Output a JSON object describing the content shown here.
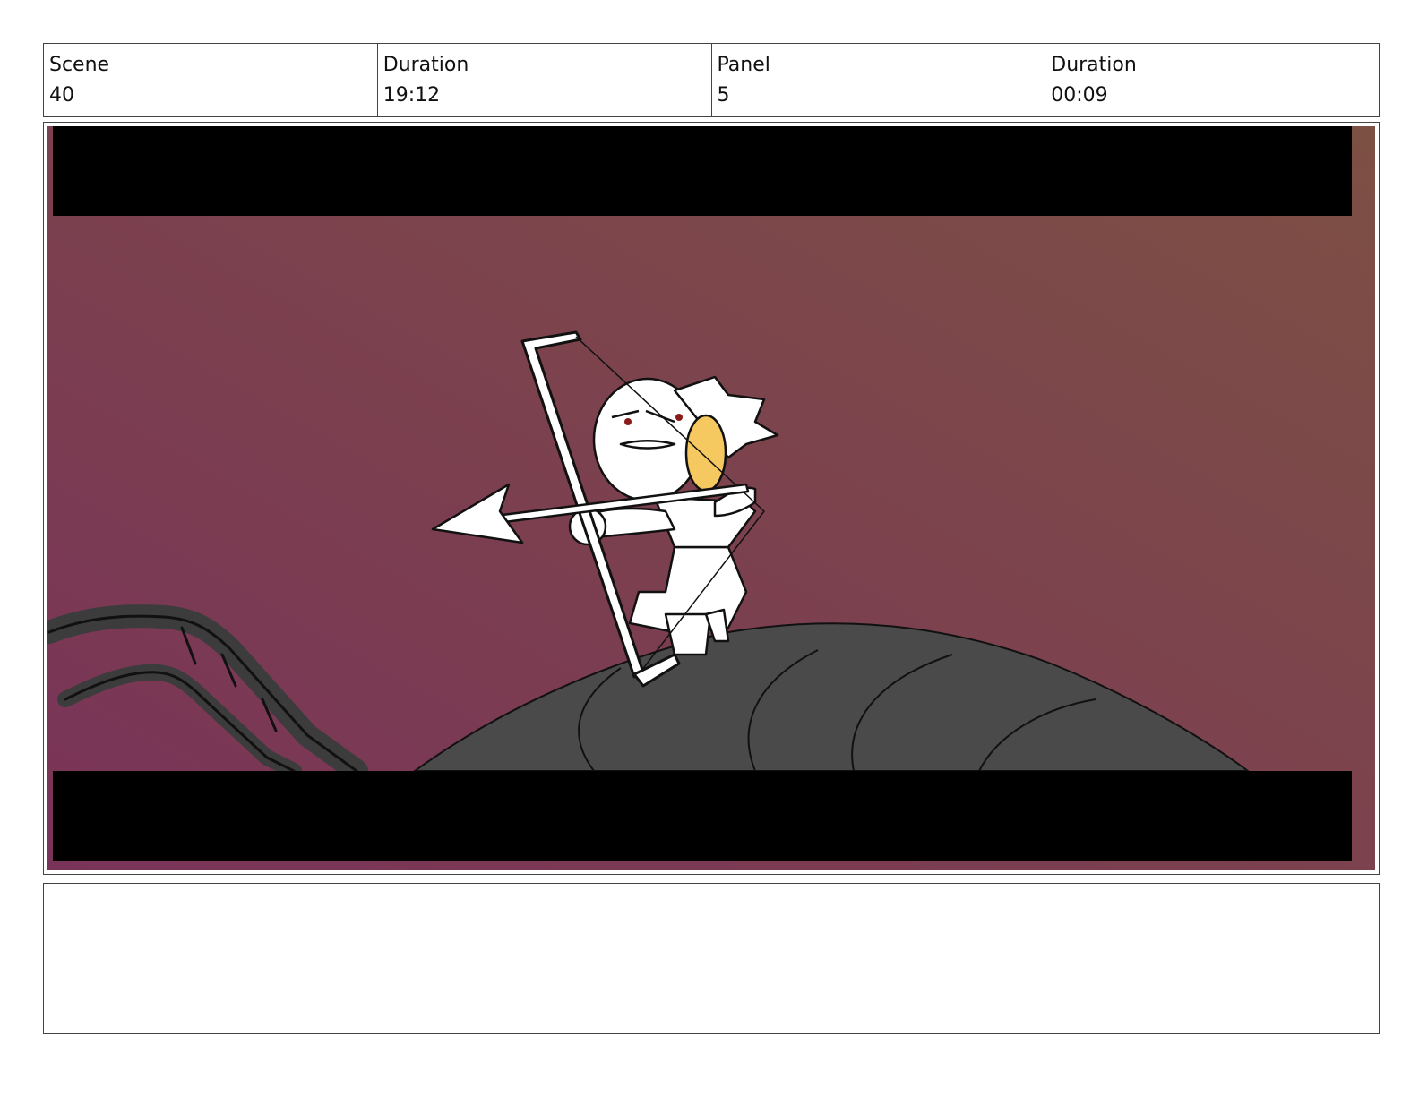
{
  "header": {
    "cells": [
      {
        "label": "Scene",
        "value": "40"
      },
      {
        "label": "Duration",
        "value": "19:12"
      },
      {
        "label": "Panel",
        "value": "5"
      },
      {
        "label": "Duration",
        "value": "00:09"
      }
    ]
  },
  "panel": {
    "colors": {
      "sky_left": "#7a3358",
      "sky_right": "#7d5044",
      "letterbox": "#000000",
      "creature": "#4a4a4a",
      "character": "#ffffff",
      "accent_yellow": "#f5c860"
    }
  },
  "notes": {
    "text": ""
  }
}
